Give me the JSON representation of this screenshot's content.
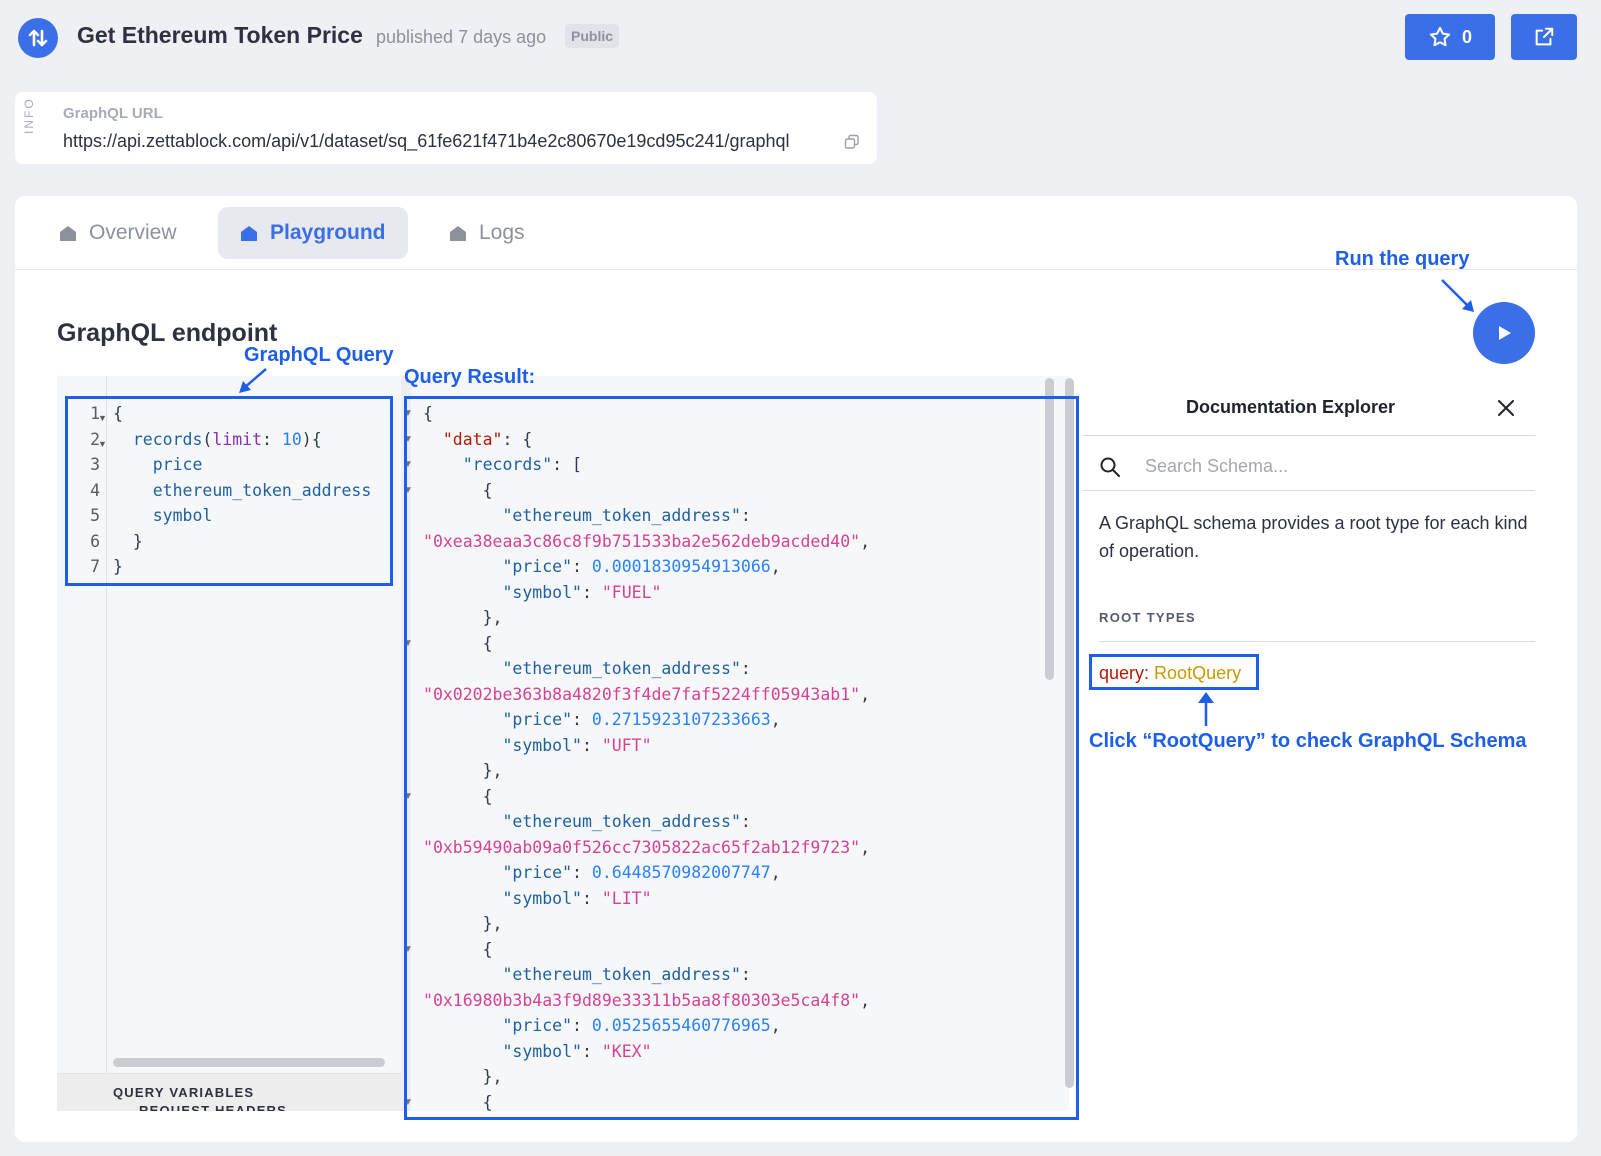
{
  "header": {
    "title": "Get Ethereum Token Price",
    "published": "published 7 days ago",
    "badge": "Public",
    "star_count": "0"
  },
  "info": {
    "tag": "INFO",
    "label": "GraphQL URL",
    "url": "https://api.zettablock.com/api/v1/dataset/sq_61fe621f471b4e2c80670e19cd95c241/graphql"
  },
  "tabs": [
    {
      "label": "Overview"
    },
    {
      "label": "Playground"
    },
    {
      "label": "Logs"
    }
  ],
  "playground": {
    "title": "GraphQL endpoint",
    "vars_label": "QUERY VARIABLES",
    "headers_label": "REQUEST HEADERS"
  },
  "annotations": {
    "run": "Run the query",
    "query": "GraphQL Query",
    "result": "Query Result:",
    "rootquery": "Click “RootQuery” to check GraphQL Schema"
  },
  "query_lines": [
    "1",
    "2",
    "3",
    "4",
    "5",
    "6",
    "7"
  ],
  "query": {
    "limit": "10",
    "fields": [
      "price",
      "ethereum_token_address",
      "symbol"
    ]
  },
  "records": [
    {
      "address": "0xea38eaa3c86c8f9b751533ba2e562deb9acded40",
      "price": "0.0001830954913066",
      "symbol": "FUEL"
    },
    {
      "address": "0x0202be363b8a4820f3f4de7faf5224ff05943ab1",
      "price": "0.2715923107233663",
      "symbol": "UFT"
    },
    {
      "address": "0xb59490ab09a0f526cc7305822ac65f2ab12f9723",
      "price": "0.6448570982007747",
      "symbol": "LIT"
    },
    {
      "address": "0x16980b3b4a3f9d89e33311b5aa8f80303e5ca4f8",
      "price": "0.0525655460776965",
      "symbol": "KEX"
    }
  ],
  "docs": {
    "title": "Documentation Explorer",
    "search_placeholder": "Search Schema...",
    "description": "A GraphQL schema provides a root type for each kind of operation.",
    "root_types_label": "ROOT TYPES",
    "root_query_key": "query",
    "root_query_type": "RootQuery"
  },
  "colors": {
    "accent": "#3b6fe8",
    "annotation": "#1d5fe8"
  }
}
